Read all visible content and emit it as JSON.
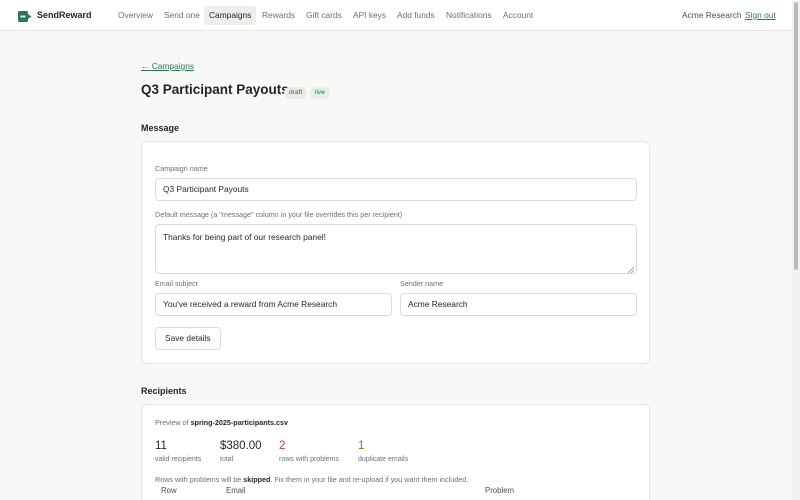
{
  "brand": {
    "name": "SendReward"
  },
  "nav": {
    "items": [
      {
        "label": "Overview"
      },
      {
        "label": "Send one"
      },
      {
        "label": "Campaigns"
      },
      {
        "label": "Rewards"
      },
      {
        "label": "Gift cards"
      },
      {
        "label": "API keys"
      },
      {
        "label": "Add funds"
      },
      {
        "label": "Notifications"
      },
      {
        "label": "Account"
      }
    ],
    "active": "Campaigns",
    "org": "Acme Research",
    "signout": "Sign out"
  },
  "page": {
    "back_link": "← Campaigns",
    "title": "Q3 Participant Payouts",
    "badges": [
      "draft",
      "live"
    ]
  },
  "message": {
    "heading": "Message",
    "campaign_name_label": "Campaign name",
    "campaign_name_value": "Q3 Participant Payouts",
    "default_message_label": "Default message (a \"message\" column in your file overrides this per recipient)",
    "default_message_value": "Thanks for being part of our research panel!",
    "email_subject_label": "Email subject",
    "email_subject_value": "You've received a reward from Acme Research",
    "sender_name_label": "Sender name",
    "sender_name_value": "Acme Research",
    "save_button": "Save details"
  },
  "recipients": {
    "heading": "Recipients",
    "preview_prefix": "Preview of",
    "preview_file": "spring-2025-participants.csv",
    "stats": [
      {
        "value": "11",
        "label": "valid recipients"
      },
      {
        "value": "$380.00",
        "label": "total"
      },
      {
        "value": "2",
        "label": "rows with problems"
      },
      {
        "value": "1",
        "label": "duplicate emails"
      }
    ],
    "note_prefix": "Rows with problems will be",
    "note_bold": "skipped",
    "note_suffix": ". Fix them in your file and re-upload if you want them included.",
    "table_headers": [
      "Row",
      "Email",
      "Problem"
    ]
  },
  "colors": {
    "accent": "#2a7a52",
    "problem": "#c0392b",
    "duplicate": "#a8680c"
  }
}
